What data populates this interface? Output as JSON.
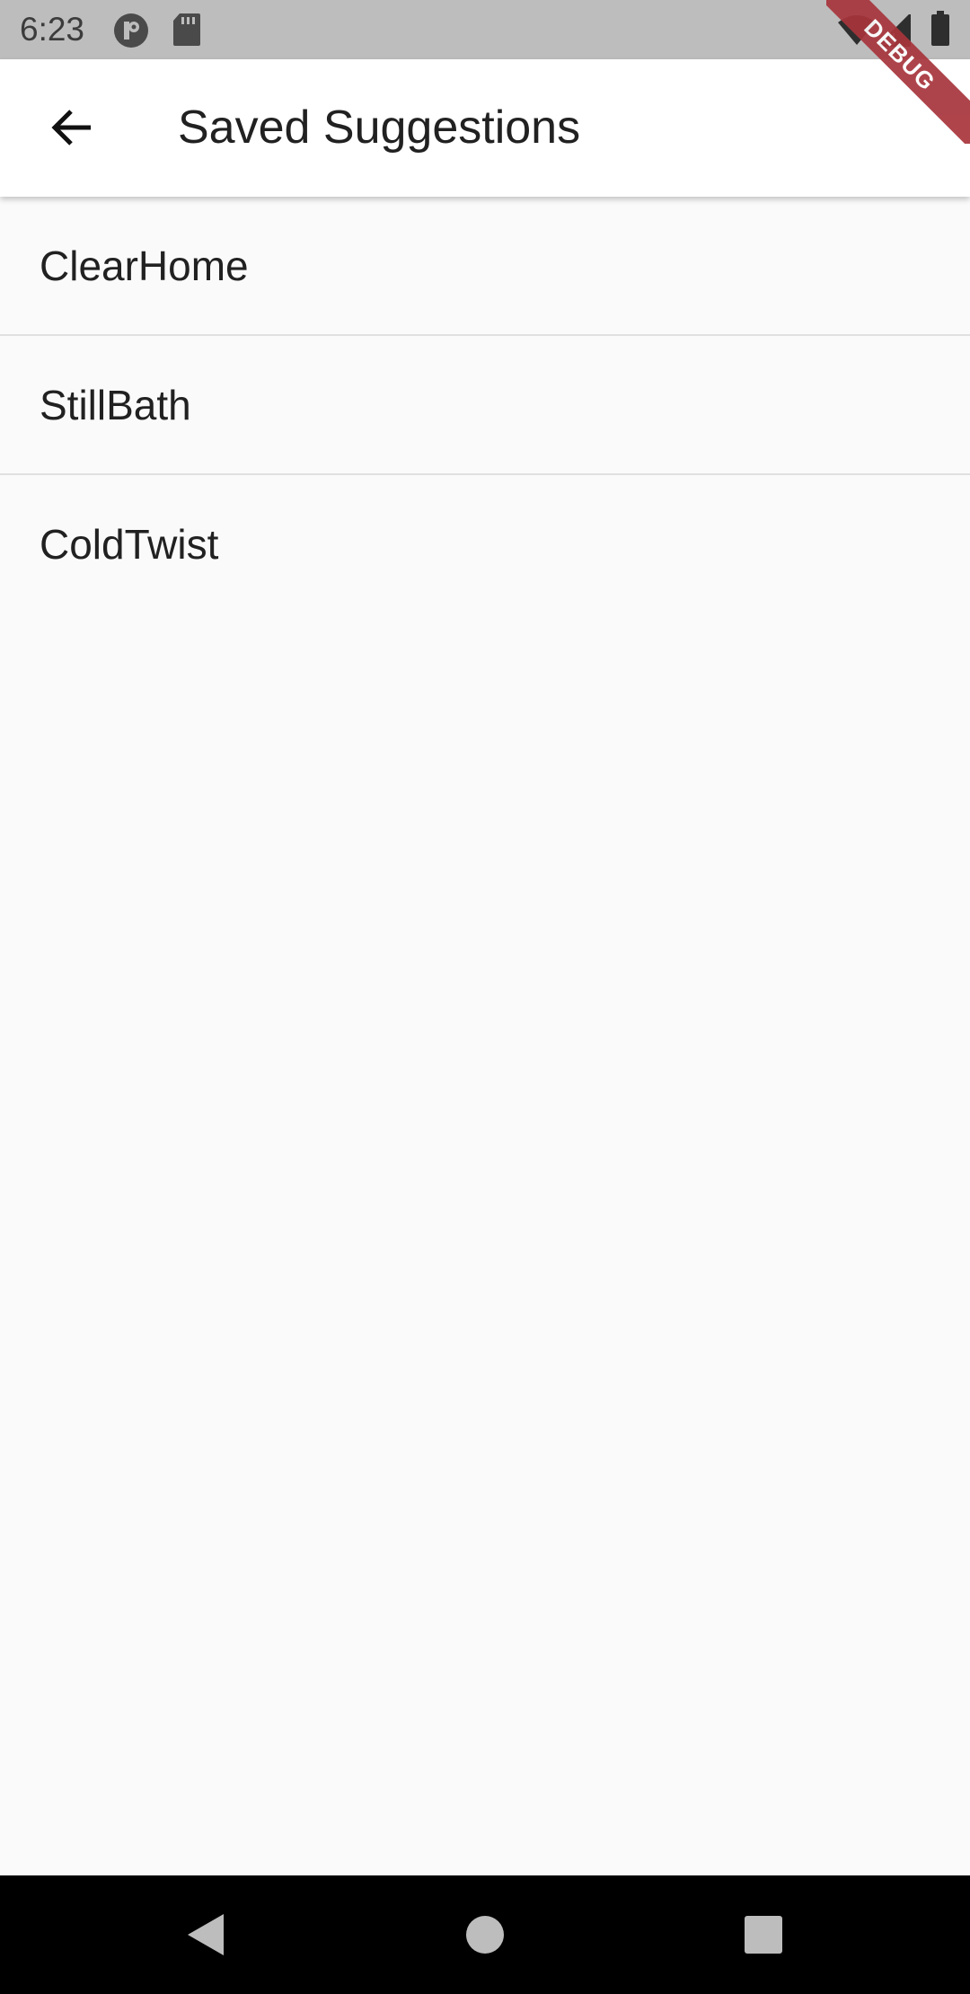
{
  "status_bar": {
    "time": "6:23",
    "icons": [
      "app-notification-icon",
      "sd-card-icon",
      "wifi-icon",
      "signal-icon",
      "battery-icon"
    ]
  },
  "app_bar": {
    "back_icon": "arrow-back-icon",
    "title": "Saved Suggestions"
  },
  "list": {
    "items": [
      {
        "label": "ClearHome"
      },
      {
        "label": "StillBath"
      },
      {
        "label": "ColdTwist"
      }
    ]
  },
  "debug_banner": {
    "label": "DEBUG"
  },
  "nav_bar": {
    "icons": [
      "nav-back-icon",
      "nav-home-icon",
      "nav-recents-icon"
    ]
  },
  "colors": {
    "status_bar_bg": "#bdbdbd",
    "app_bar_bg": "#ffffff",
    "body_bg": "#fafafa",
    "debug_banner": "#a8353c",
    "nav_bar_bg": "#000000"
  }
}
